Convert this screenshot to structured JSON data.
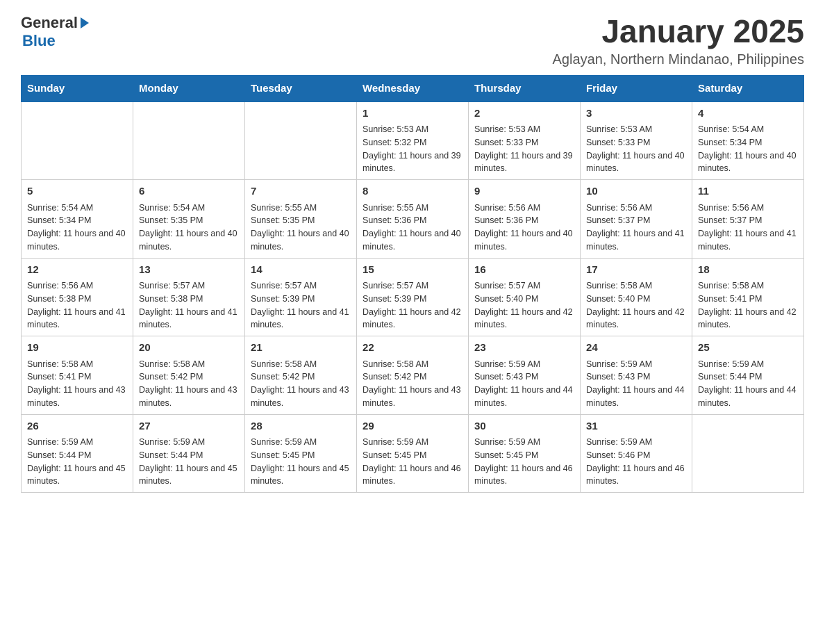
{
  "header": {
    "logo_general": "General",
    "logo_blue": "Blue",
    "month_title": "January 2025",
    "location": "Aglayan, Northern Mindanao, Philippines"
  },
  "days_of_week": [
    "Sunday",
    "Monday",
    "Tuesday",
    "Wednesday",
    "Thursday",
    "Friday",
    "Saturday"
  ],
  "weeks": [
    [
      {
        "day": "",
        "sunrise": "",
        "sunset": "",
        "daylight": ""
      },
      {
        "day": "",
        "sunrise": "",
        "sunset": "",
        "daylight": ""
      },
      {
        "day": "",
        "sunrise": "",
        "sunset": "",
        "daylight": ""
      },
      {
        "day": "1",
        "sunrise": "Sunrise: 5:53 AM",
        "sunset": "Sunset: 5:32 PM",
        "daylight": "Daylight: 11 hours and 39 minutes."
      },
      {
        "day": "2",
        "sunrise": "Sunrise: 5:53 AM",
        "sunset": "Sunset: 5:33 PM",
        "daylight": "Daylight: 11 hours and 39 minutes."
      },
      {
        "day": "3",
        "sunrise": "Sunrise: 5:53 AM",
        "sunset": "Sunset: 5:33 PM",
        "daylight": "Daylight: 11 hours and 40 minutes."
      },
      {
        "day": "4",
        "sunrise": "Sunrise: 5:54 AM",
        "sunset": "Sunset: 5:34 PM",
        "daylight": "Daylight: 11 hours and 40 minutes."
      }
    ],
    [
      {
        "day": "5",
        "sunrise": "Sunrise: 5:54 AM",
        "sunset": "Sunset: 5:34 PM",
        "daylight": "Daylight: 11 hours and 40 minutes."
      },
      {
        "day": "6",
        "sunrise": "Sunrise: 5:54 AM",
        "sunset": "Sunset: 5:35 PM",
        "daylight": "Daylight: 11 hours and 40 minutes."
      },
      {
        "day": "7",
        "sunrise": "Sunrise: 5:55 AM",
        "sunset": "Sunset: 5:35 PM",
        "daylight": "Daylight: 11 hours and 40 minutes."
      },
      {
        "day": "8",
        "sunrise": "Sunrise: 5:55 AM",
        "sunset": "Sunset: 5:36 PM",
        "daylight": "Daylight: 11 hours and 40 minutes."
      },
      {
        "day": "9",
        "sunrise": "Sunrise: 5:56 AM",
        "sunset": "Sunset: 5:36 PM",
        "daylight": "Daylight: 11 hours and 40 minutes."
      },
      {
        "day": "10",
        "sunrise": "Sunrise: 5:56 AM",
        "sunset": "Sunset: 5:37 PM",
        "daylight": "Daylight: 11 hours and 41 minutes."
      },
      {
        "day": "11",
        "sunrise": "Sunrise: 5:56 AM",
        "sunset": "Sunset: 5:37 PM",
        "daylight": "Daylight: 11 hours and 41 minutes."
      }
    ],
    [
      {
        "day": "12",
        "sunrise": "Sunrise: 5:56 AM",
        "sunset": "Sunset: 5:38 PM",
        "daylight": "Daylight: 11 hours and 41 minutes."
      },
      {
        "day": "13",
        "sunrise": "Sunrise: 5:57 AM",
        "sunset": "Sunset: 5:38 PM",
        "daylight": "Daylight: 11 hours and 41 minutes."
      },
      {
        "day": "14",
        "sunrise": "Sunrise: 5:57 AM",
        "sunset": "Sunset: 5:39 PM",
        "daylight": "Daylight: 11 hours and 41 minutes."
      },
      {
        "day": "15",
        "sunrise": "Sunrise: 5:57 AM",
        "sunset": "Sunset: 5:39 PM",
        "daylight": "Daylight: 11 hours and 42 minutes."
      },
      {
        "day": "16",
        "sunrise": "Sunrise: 5:57 AM",
        "sunset": "Sunset: 5:40 PM",
        "daylight": "Daylight: 11 hours and 42 minutes."
      },
      {
        "day": "17",
        "sunrise": "Sunrise: 5:58 AM",
        "sunset": "Sunset: 5:40 PM",
        "daylight": "Daylight: 11 hours and 42 minutes."
      },
      {
        "day": "18",
        "sunrise": "Sunrise: 5:58 AM",
        "sunset": "Sunset: 5:41 PM",
        "daylight": "Daylight: 11 hours and 42 minutes."
      }
    ],
    [
      {
        "day": "19",
        "sunrise": "Sunrise: 5:58 AM",
        "sunset": "Sunset: 5:41 PM",
        "daylight": "Daylight: 11 hours and 43 minutes."
      },
      {
        "day": "20",
        "sunrise": "Sunrise: 5:58 AM",
        "sunset": "Sunset: 5:42 PM",
        "daylight": "Daylight: 11 hours and 43 minutes."
      },
      {
        "day": "21",
        "sunrise": "Sunrise: 5:58 AM",
        "sunset": "Sunset: 5:42 PM",
        "daylight": "Daylight: 11 hours and 43 minutes."
      },
      {
        "day": "22",
        "sunrise": "Sunrise: 5:58 AM",
        "sunset": "Sunset: 5:42 PM",
        "daylight": "Daylight: 11 hours and 43 minutes."
      },
      {
        "day": "23",
        "sunrise": "Sunrise: 5:59 AM",
        "sunset": "Sunset: 5:43 PM",
        "daylight": "Daylight: 11 hours and 44 minutes."
      },
      {
        "day": "24",
        "sunrise": "Sunrise: 5:59 AM",
        "sunset": "Sunset: 5:43 PM",
        "daylight": "Daylight: 11 hours and 44 minutes."
      },
      {
        "day": "25",
        "sunrise": "Sunrise: 5:59 AM",
        "sunset": "Sunset: 5:44 PM",
        "daylight": "Daylight: 11 hours and 44 minutes."
      }
    ],
    [
      {
        "day": "26",
        "sunrise": "Sunrise: 5:59 AM",
        "sunset": "Sunset: 5:44 PM",
        "daylight": "Daylight: 11 hours and 45 minutes."
      },
      {
        "day": "27",
        "sunrise": "Sunrise: 5:59 AM",
        "sunset": "Sunset: 5:44 PM",
        "daylight": "Daylight: 11 hours and 45 minutes."
      },
      {
        "day": "28",
        "sunrise": "Sunrise: 5:59 AM",
        "sunset": "Sunset: 5:45 PM",
        "daylight": "Daylight: 11 hours and 45 minutes."
      },
      {
        "day": "29",
        "sunrise": "Sunrise: 5:59 AM",
        "sunset": "Sunset: 5:45 PM",
        "daylight": "Daylight: 11 hours and 46 minutes."
      },
      {
        "day": "30",
        "sunrise": "Sunrise: 5:59 AM",
        "sunset": "Sunset: 5:45 PM",
        "daylight": "Daylight: 11 hours and 46 minutes."
      },
      {
        "day": "31",
        "sunrise": "Sunrise: 5:59 AM",
        "sunset": "Sunset: 5:46 PM",
        "daylight": "Daylight: 11 hours and 46 minutes."
      },
      {
        "day": "",
        "sunrise": "",
        "sunset": "",
        "daylight": ""
      }
    ]
  ]
}
